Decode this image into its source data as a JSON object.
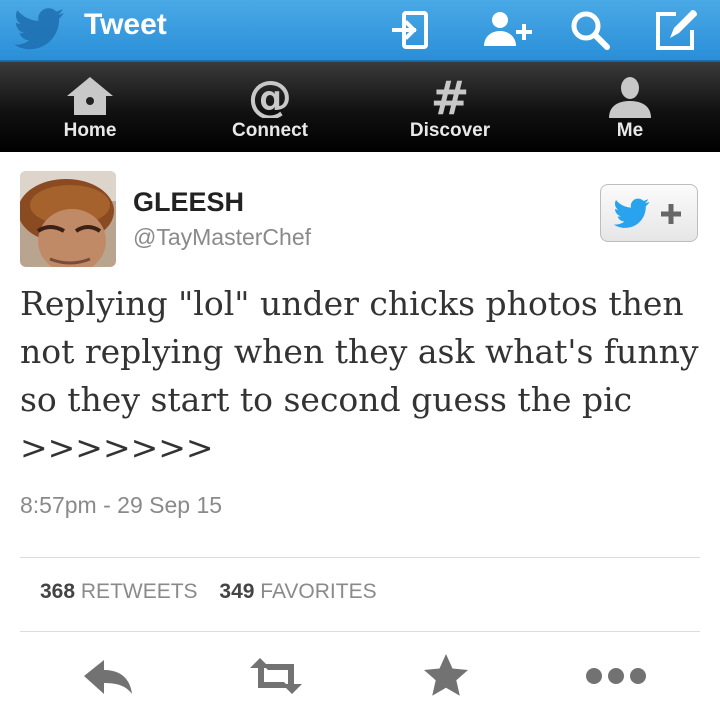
{
  "header": {
    "title": "Tweet",
    "icons": [
      "twitter-bird-logo",
      "sign-in-icon",
      "add-user-icon",
      "search-icon",
      "compose-icon"
    ]
  },
  "nav": {
    "tabs": [
      {
        "label": "Home",
        "icon": "home-icon"
      },
      {
        "label": "Connect",
        "icon": "at-icon"
      },
      {
        "label": "Discover",
        "icon": "hash-icon"
      },
      {
        "label": "Me",
        "icon": "person-icon",
        "active": true
      }
    ]
  },
  "tweet": {
    "display_name": "GLEESH",
    "handle": "@TayMasterChef",
    "text": "Replying \"lol\" under chicks photos then not replying when they ask what's funny so they start to second guess the pic >>>>>>>",
    "timestamp": "8:57pm - 29 Sep 15",
    "follow_icon": "follow-bird-plus-icon"
  },
  "stats": {
    "retweets_count": "368",
    "retweets_label": "RETWEETS",
    "favorites_count": "349",
    "favorites_label": "FAVORITES"
  },
  "actions": [
    "reply-icon",
    "retweet-icon",
    "favorite-icon",
    "more-icon"
  ],
  "colors": {
    "topbar": "#2a8fd8",
    "navbar": "#111111",
    "twitter_blue": "#2aa3ef",
    "text": "#333333",
    "muted": "#8a8a8a"
  }
}
